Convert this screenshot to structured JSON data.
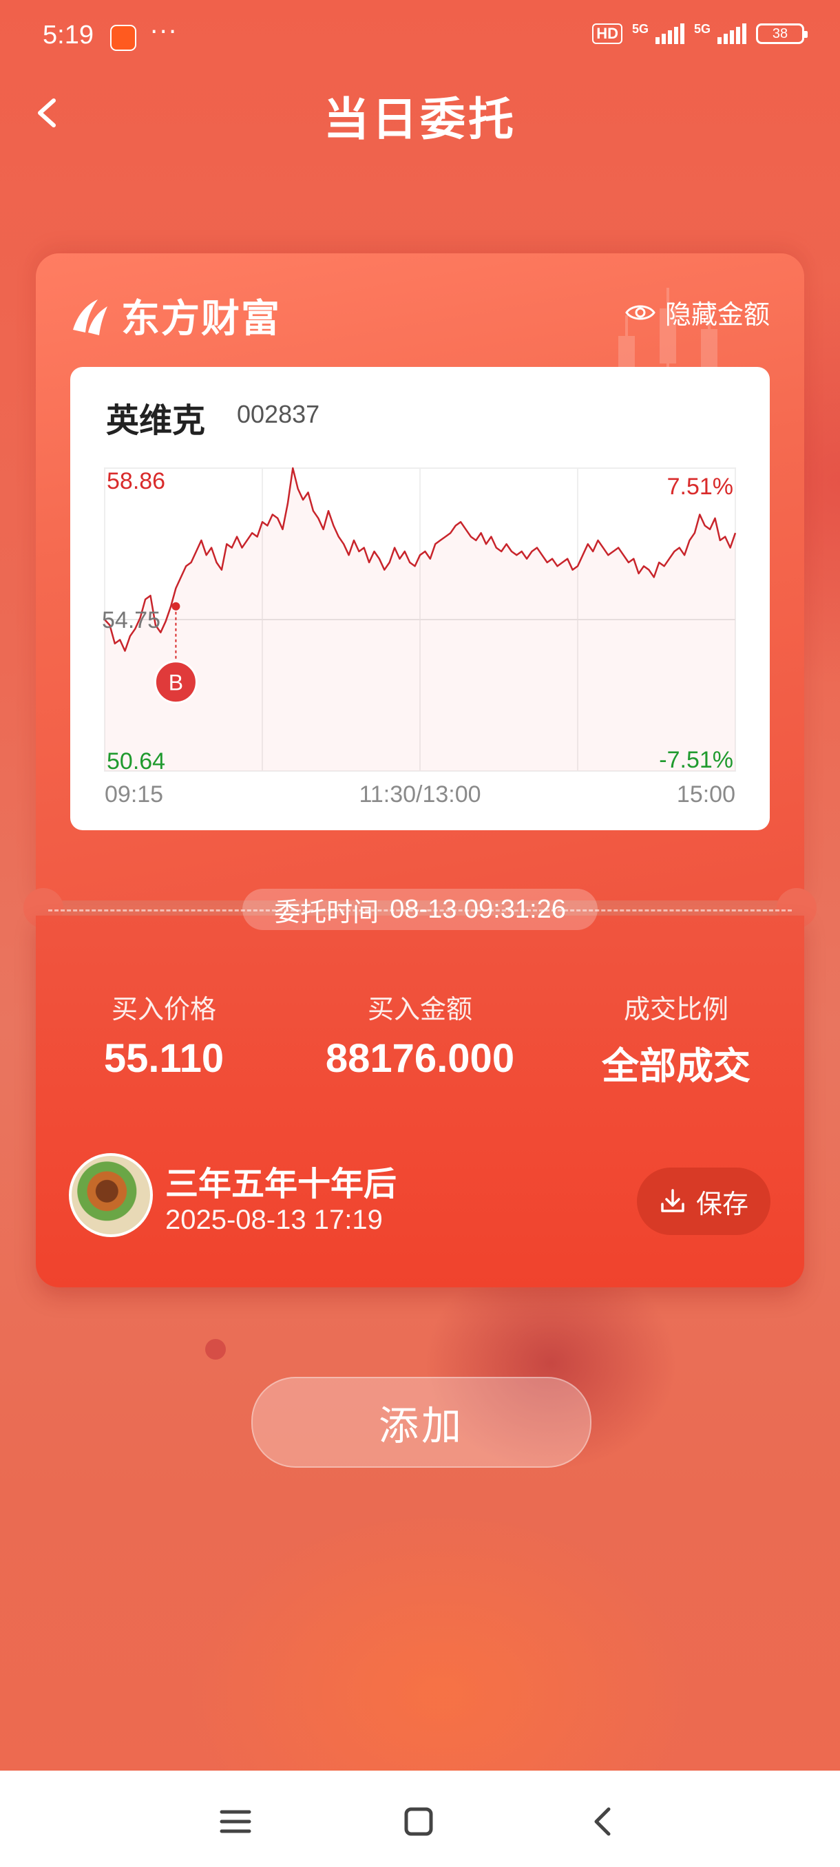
{
  "status_bar": {
    "time": "5:19",
    "dots": "···",
    "hd": "HD",
    "net1": "5G",
    "net2": "5G",
    "battery": "38"
  },
  "header": {
    "title": "当日委托",
    "back_icon": "chevron-left-icon"
  },
  "card": {
    "brand": "东方财富",
    "hide_label": "隐藏金额",
    "stock": {
      "name": "英维克",
      "code": "002837"
    },
    "entrust_time_label": "委托时间",
    "entrust_time_value": "08-13 09:31:26",
    "stats": [
      {
        "label": "买入价格",
        "value": "55.110"
      },
      {
        "label": "买入金额",
        "value": "88176.000"
      },
      {
        "label": "成交比例",
        "value": "全部成交"
      }
    ],
    "user": {
      "name": "三年五年十年后",
      "time": "2025-08-13 17:19"
    },
    "save_label": "保存"
  },
  "add_label": "添加",
  "colors": {
    "accent": "#ef4a33",
    "up": "#d92b2b",
    "down": "#1f9a2e",
    "line": "#c8242b"
  },
  "chart_data": {
    "type": "line",
    "title": "",
    "x_ticks": [
      "09:15",
      "11:30/13:00",
      "15:00"
    ],
    "y_max_label": "58.86",
    "y_ref_label": "54.75",
    "y_min_label": "50.64",
    "pct_max_label": "7.51%",
    "pct_min_label": "-7.51%",
    "ylim": [
      50.64,
      58.86
    ],
    "prev_close": 54.75,
    "buy_marker": {
      "label": "B",
      "price": 55.11
    },
    "values": [
      54.75,
      54.6,
      54.1,
      54.2,
      53.9,
      54.3,
      54.5,
      54.8,
      55.3,
      55.4,
      54.6,
      54.4,
      54.7,
      55.1,
      55.6,
      55.9,
      56.2,
      56.3,
      56.6,
      56.9,
      56.5,
      56.7,
      56.3,
      56.1,
      56.8,
      56.7,
      57.0,
      56.7,
      56.9,
      57.1,
      57.0,
      57.4,
      57.3,
      57.6,
      57.5,
      57.2,
      57.9,
      58.86,
      58.3,
      58.0,
      58.2,
      57.7,
      57.5,
      57.2,
      57.7,
      57.3,
      57.0,
      56.8,
      56.5,
      56.9,
      56.6,
      56.7,
      56.3,
      56.6,
      56.4,
      56.1,
      56.3,
      56.7,
      56.4,
      56.6,
      56.3,
      56.2,
      56.5,
      56.6,
      56.4,
      56.8,
      56.9,
      57.0,
      57.1,
      57.3,
      57.4,
      57.2,
      57.0,
      56.9,
      57.1,
      56.8,
      57.0,
      56.7,
      56.6,
      56.8,
      56.6,
      56.5,
      56.6,
      56.4,
      56.6,
      56.7,
      56.5,
      56.3,
      56.4,
      56.2,
      56.3,
      56.4,
      56.1,
      56.2,
      56.5,
      56.8,
      56.6,
      56.9,
      56.7,
      56.5,
      56.6,
      56.7,
      56.5,
      56.3,
      56.4,
      56.0,
      56.2,
      56.1,
      55.9,
      56.3,
      56.2,
      56.4,
      56.6,
      56.7,
      56.5,
      56.9,
      57.1,
      57.6,
      57.3,
      57.2,
      57.5,
      56.9,
      57.0,
      56.7,
      57.1
    ]
  }
}
